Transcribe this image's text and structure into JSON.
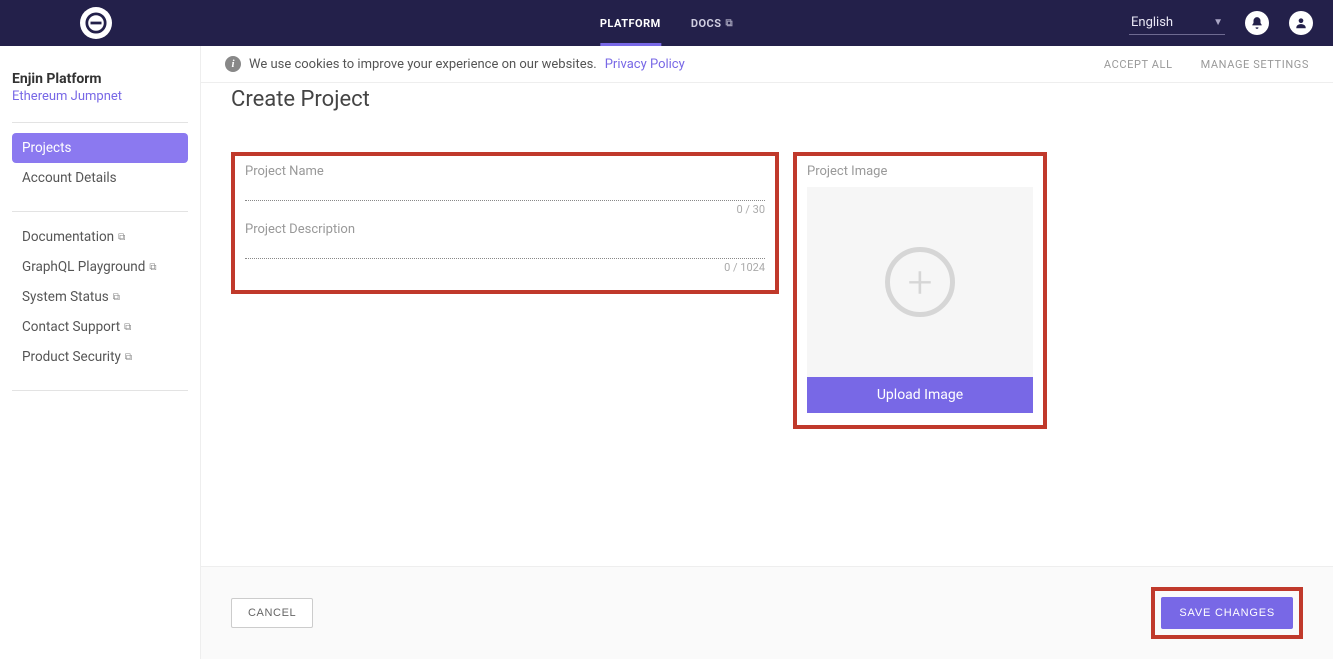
{
  "topnav": {
    "platform": "PLATFORM",
    "docs": "DOCS"
  },
  "language": "English",
  "sidebar": {
    "title": "Enjin Platform",
    "network": "Ethereum Jumpnet",
    "group1": [
      {
        "label": "Projects",
        "active": true
      },
      {
        "label": "Account Details",
        "active": false
      }
    ],
    "group2": [
      {
        "label": "Documentation",
        "external": true
      },
      {
        "label": "GraphQL Playground",
        "external": true
      },
      {
        "label": "System Status",
        "external": true
      },
      {
        "label": "Contact Support",
        "external": true
      },
      {
        "label": "Product Security",
        "external": true
      }
    ]
  },
  "cookies": {
    "text": "We use cookies to improve your experience on our websites.",
    "link": "Privacy Policy",
    "accept": "ACCEPT ALL",
    "manage": "MANAGE SETTINGS"
  },
  "page": {
    "title": "Create Project",
    "name_label": "Project Name",
    "name_value": "",
    "name_counter": "0 / 30",
    "desc_label": "Project Description",
    "desc_value": "",
    "desc_counter": "0 / 1024",
    "image_label": "Project Image",
    "upload": "Upload Image",
    "cancel": "CANCEL",
    "save": "SAVE CHANGES"
  }
}
